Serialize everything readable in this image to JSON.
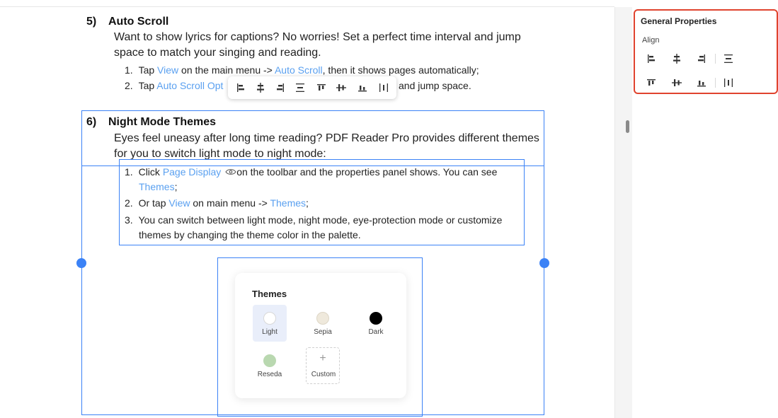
{
  "document": {
    "section5": {
      "number": "5)",
      "title": "Auto Scroll",
      "para_line1": "Want to show lyrics for captions? No worries! Set a perfect time interval and jump",
      "para_line2": "space to match your singing and reading.",
      "item1": {
        "num": "1.",
        "pre": "Tap ",
        "link1": "View",
        "mid": " on the main menu -> ",
        "link2": "Auto Scroll",
        "post": ", then it shows pages automatically;"
      },
      "item2": {
        "num": "2.",
        "pre": "Tap ",
        "link1": "Auto Scroll Opt",
        "post": "and jump space."
      }
    },
    "section6": {
      "number": "6)",
      "title": "Night Mode Themes",
      "para_line1": "Eyes feel uneasy after long time reading? PDF Reader Pro provides different themes",
      "para_line2": "for you to switch light mode to night mode:",
      "item1": {
        "num": "1.",
        "pre": "Click ",
        "link1": "Page Display",
        "post": "on the toolbar and the properties panel shows. You can see",
        "link2": "Themes",
        "post2": ";"
      },
      "item2": {
        "num": "2.",
        "pre": "Or tap ",
        "link1": "View",
        "mid": " on main menu -> ",
        "link2": "Themes",
        "post": ";"
      },
      "item3": {
        "num": "3.",
        "line1": "You can switch between light mode, night mode, eye-protection mode or customize",
        "line2": "themes by changing the theme color in the palette."
      }
    },
    "themes_card": {
      "title": "Themes",
      "options": [
        {
          "label": "Light",
          "color": "#ffffff",
          "selected": true
        },
        {
          "label": "Sepia",
          "color": "#efe9dc",
          "selected": false
        },
        {
          "label": "Dark",
          "color": "#000000",
          "selected": false
        },
        {
          "label": "Reseda",
          "color": "#b9d8b0",
          "selected": false
        },
        {
          "label": "Custom",
          "symbol": "+",
          "selected": false
        }
      ]
    }
  },
  "floating_toolbar": {
    "icons": [
      "align-left-icon",
      "align-horizontal-center-icon",
      "align-right-icon",
      "distribute-horizontal-icon",
      "align-top-icon",
      "align-vertical-center-icon",
      "align-bottom-icon",
      "distribute-vertical-icon"
    ]
  },
  "properties_panel": {
    "title": "General Properties",
    "section_label": "Align",
    "row1_icons": [
      "align-left-icon",
      "align-horizontal-center-icon",
      "align-right-icon",
      "distribute-horizontal-icon"
    ],
    "row2_icons": [
      "align-top-icon",
      "align-vertical-center-icon",
      "align-bottom-icon",
      "distribute-vertical-icon"
    ]
  },
  "colors": {
    "link": "#5aa0f0",
    "selection": "#3b82f6",
    "panel_highlight": "#e0432e"
  }
}
